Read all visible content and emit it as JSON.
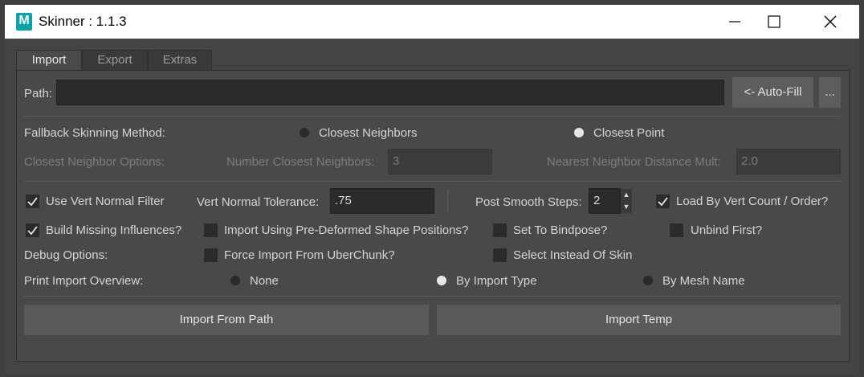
{
  "window": {
    "logo_letter": "M",
    "title": "Skinner : 1.1.3",
    "accent": "#0aa3a8"
  },
  "tabs": [
    {
      "label": "Import",
      "active": true
    },
    {
      "label": "Export",
      "active": false
    },
    {
      "label": "Extras",
      "active": false
    }
  ],
  "path": {
    "label": "Path:",
    "value": "",
    "autofill_label": "<- Auto-Fill",
    "browse_label": "..."
  },
  "fallback": {
    "label": "Fallback Skinning Method:",
    "option_neighbors": "Closest Neighbors",
    "option_point": "Closest Point",
    "selected": "Closest Point"
  },
  "neighbor_options": {
    "label": "Closest Neighbor Options:",
    "num_label": "Number Closest Neighbors:",
    "num_value": "3",
    "dist_label": "Nearest Neighbor Distance Mult:",
    "dist_value": "2.0"
  },
  "vert_row": {
    "use_vert_normal_label": "Use Vert Normal Filter",
    "use_vert_normal_checked": true,
    "tolerance_label": "Vert Normal Tolerance:",
    "tolerance_value": ".75",
    "smooth_label": "Post Smooth Steps:",
    "smooth_value": "2",
    "load_by_vert_label": "Load By Vert Count / Order?",
    "load_by_vert_checked": true
  },
  "options_row": {
    "build_missing_label": "Build Missing Influences?",
    "build_missing_checked": true,
    "pre_deformed_label": "Import Using Pre-Deformed Shape Positions?",
    "pre_deformed_checked": false,
    "bindpose_label": "Set To Bindpose?",
    "bindpose_checked": false,
    "unbind_label": "Unbind First?",
    "unbind_checked": false
  },
  "debug_row": {
    "label": "Debug Options:",
    "force_uberchunk_label": "Force Import From UberChunk?",
    "force_uberchunk_checked": false,
    "select_instead_label": "Select Instead Of Skin",
    "select_instead_checked": false
  },
  "overview": {
    "label": "Print Import Overview:",
    "option_none": "None",
    "option_type": "By Import Type",
    "option_mesh": "By Mesh Name",
    "selected": "By Import Type"
  },
  "actions": {
    "import_path_label": "Import From Path",
    "import_temp_label": "Import Temp"
  }
}
